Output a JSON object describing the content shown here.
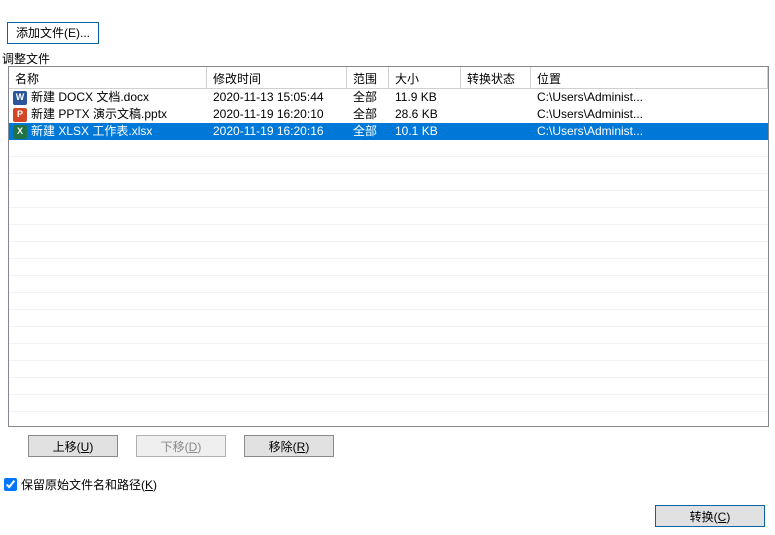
{
  "buttons": {
    "add_file": "添加文件(E)...",
    "move_up": "上移(U)",
    "move_down": "下移(D)",
    "remove": "移除(R)",
    "convert": "转换(C)"
  },
  "labels": {
    "adjust_files": "调整文件",
    "keep_original": "保留原始文件名和路径(K)"
  },
  "headers": {
    "name": "名称",
    "modified": "修改时间",
    "range": "范围",
    "size": "大小",
    "status": "转换状态",
    "location": "位置"
  },
  "rows": [
    {
      "icon": "docx",
      "name": "新建 DOCX 文档.docx",
      "modified": "2020-11-13 15:05:44",
      "range": "全部",
      "size": "11.9 KB",
      "status": "",
      "location": "C:\\Users\\Administ...",
      "selected": false
    },
    {
      "icon": "pptx",
      "name": "新建 PPTX 演示文稿.pptx",
      "modified": "2020-11-19 16:20:10",
      "range": "全部",
      "size": "28.6 KB",
      "status": "",
      "location": "C:\\Users\\Administ...",
      "selected": false
    },
    {
      "icon": "xlsx",
      "name": "新建 XLSX 工作表.xlsx",
      "modified": "2020-11-19 16:20:16",
      "range": "全部",
      "size": "10.1 KB",
      "status": "",
      "location": "C:\\Users\\Administ...",
      "selected": true
    }
  ],
  "keep_original_checked": true,
  "icon_glyph": {
    "docx": "W",
    "pptx": "P",
    "xlsx": "X"
  }
}
